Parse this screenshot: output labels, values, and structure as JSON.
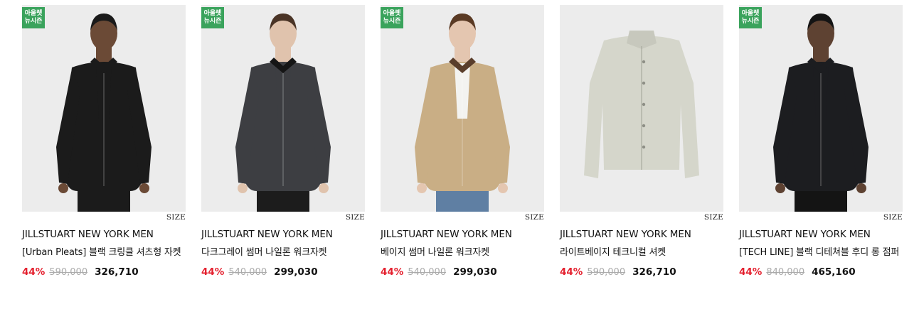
{
  "products": [
    {
      "badge_line1": "아울렛",
      "badge_line2": "뉴시즌",
      "size_label": "SIZE",
      "brand": "JILLSTUART NEW YORK MEN",
      "name": "[Urban Pleats] 블랙 크링클 셔츠형 자켓",
      "discount": "44%",
      "original_price": "590,000",
      "price": "326,710",
      "jacket_color": "#1b1b1b",
      "collar_color": "#1b1b1b",
      "inner_color": "#1b1b1b",
      "pants_color": "#1b1b1b",
      "skin_color": "#6b4a36",
      "hair_color": "#1a1a1a"
    },
    {
      "badge_line1": "아울렛",
      "badge_line2": "뉴시즌",
      "size_label": "SIZE",
      "brand": "JILLSTUART NEW YORK MEN",
      "name": "다크그레이 썸머 나일론 워크자켓",
      "discount": "44%",
      "original_price": "540,000",
      "price": "299,030",
      "jacket_color": "#3d3e42",
      "collar_color": "#151515",
      "inner_color": "#3d3e42",
      "pants_color": "#1c1c1c",
      "skin_color": "#e0c3ad",
      "hair_color": "#4a3426"
    },
    {
      "badge_line1": "아울렛",
      "badge_line2": "뉴시즌",
      "size_label": "SIZE",
      "brand": "JILLSTUART NEW YORK MEN",
      "name": "베이지 썸머 나일론 워크자켓",
      "discount": "44%",
      "original_price": "540,000",
      "price": "299,030",
      "jacket_color": "#c9ae85",
      "collar_color": "#5a3e2b",
      "inner_color": "#f3f3f0",
      "pants_color": "#5f7fa3",
      "skin_color": "#e4c6b0",
      "hair_color": "#5a3a24"
    },
    {
      "badge_line1": "",
      "badge_line2": "",
      "size_label": "SIZE",
      "brand": "JILLSTUART NEW YORK MEN",
      "name": "라이트베이지 테크니컬 셔켓",
      "discount": "44%",
      "original_price": "590,000",
      "price": "326,710",
      "jacket_color": "#d5d6cb",
      "collar_color": "#d5d6cb",
      "inner_color": "#d5d6cb",
      "pants_color": "",
      "skin_color": "",
      "hair_color": ""
    },
    {
      "badge_line1": "아울렛",
      "badge_line2": "뉴시즌",
      "size_label": "SIZE",
      "brand": "JILLSTUART NEW YORK MEN",
      "name": "[TECH LINE] 블랙 디테쳐블 후디 롱 점퍼",
      "discount": "44%",
      "original_price": "840,000",
      "price": "465,160",
      "jacket_color": "#1c1d20",
      "collar_color": "#1c1d20",
      "inner_color": "#1c1d20",
      "pants_color": "#141414",
      "skin_color": "#5e4232",
      "hair_color": "#141414"
    }
  ]
}
